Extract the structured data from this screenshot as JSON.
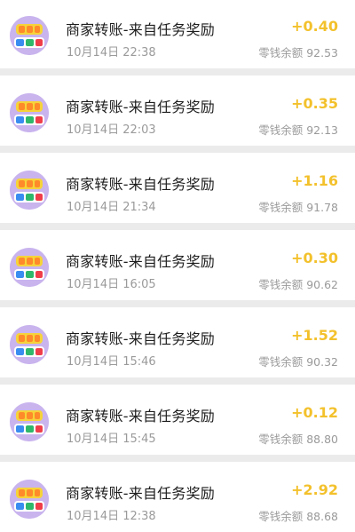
{
  "colors": {
    "page_background": "#ebebeb",
    "card_background": "#ffffff",
    "amount_color": "#f3c12c",
    "title_color": "#1d1d1d",
    "secondary_text": "#9a9a9a",
    "avatar_background": "#c9b4ee"
  },
  "balance_label": "零钱余额",
  "transactions": [
    {
      "title": "商家转账-来自任务奖励",
      "time": "10月14日 22:38",
      "amount": "+0.40",
      "balance": "92.53",
      "avatar_icon": "merchant-logo-icon"
    },
    {
      "title": "商家转账-来自任务奖励",
      "time": "10月14日 22:03",
      "amount": "+0.35",
      "balance": "92.13",
      "avatar_icon": "merchant-logo-icon"
    },
    {
      "title": "商家转账-来自任务奖励",
      "time": "10月14日 21:34",
      "amount": "+1.16",
      "balance": "91.78",
      "avatar_icon": "merchant-logo-icon"
    },
    {
      "title": "商家转账-来自任务奖励",
      "time": "10月14日 16:05",
      "amount": "+0.30",
      "balance": "90.62",
      "avatar_icon": "merchant-logo-icon"
    },
    {
      "title": "商家转账-来自任务奖励",
      "time": "10月14日 15:46",
      "amount": "+1.52",
      "balance": "90.32",
      "avatar_icon": "merchant-logo-icon"
    },
    {
      "title": "商家转账-来自任务奖励",
      "time": "10月14日 15:45",
      "amount": "+0.12",
      "balance": "88.80",
      "avatar_icon": "merchant-logo-icon"
    },
    {
      "title": "商家转账-来自任务奖励",
      "time": "10月14日 12:38",
      "amount": "+2.92",
      "balance": "88.68",
      "avatar_icon": "merchant-logo-icon"
    }
  ]
}
